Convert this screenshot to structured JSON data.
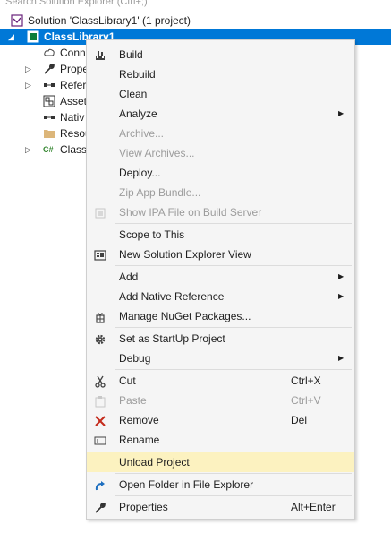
{
  "search": {
    "placeholder": "Search Solution Explorer (Ctrl+;)"
  },
  "tree": {
    "solution_label": "Solution 'ClassLibrary1' (1 project)",
    "project_label": "ClassLibrary1",
    "items": [
      "Conn",
      "Prope",
      "Refere",
      "Asset",
      "Nativ",
      "Resou",
      "Class"
    ]
  },
  "menu": {
    "build": "Build",
    "rebuild": "Rebuild",
    "clean": "Clean",
    "analyze": "Analyze",
    "archive": "Archive...",
    "view_archives": "View Archives...",
    "deploy": "Deploy...",
    "zip_app_bundle": "Zip App Bundle...",
    "show_ipa": "Show IPA File on Build Server",
    "scope_to_this": "Scope to This",
    "new_solution_view": "New Solution Explorer View",
    "add": "Add",
    "add_native_reference": "Add Native Reference",
    "manage_nuget": "Manage NuGet Packages...",
    "set_startup": "Set as StartUp Project",
    "debug": "Debug",
    "cut": "Cut",
    "cut_shortcut": "Ctrl+X",
    "paste": "Paste",
    "paste_shortcut": "Ctrl+V",
    "remove": "Remove",
    "remove_shortcut": "Del",
    "rename": "Rename",
    "unload_project": "Unload Project",
    "open_folder": "Open Folder in File Explorer",
    "properties": "Properties",
    "properties_shortcut": "Alt+Enter"
  },
  "colors": {
    "selection": "#0078d7",
    "highlight": "#fcf2c0",
    "remove_icon": "#c42b1c",
    "disabled": "#9c9c9c"
  }
}
